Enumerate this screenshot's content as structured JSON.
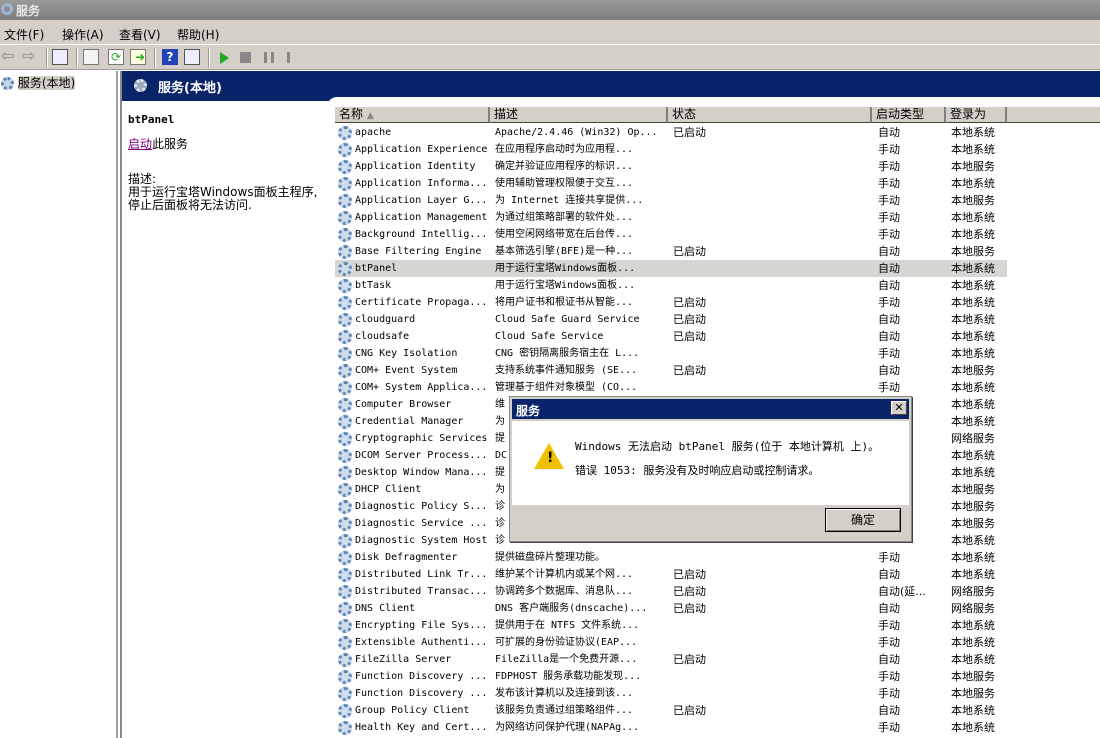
{
  "window": {
    "title": "服务"
  },
  "menu": [
    "文件(F)",
    "操作(A)",
    "查看(V)",
    "帮助(H)"
  ],
  "toolbar_icons": [
    "back-icon",
    "forward-icon",
    "show-hide-tree-icon",
    "properties-icon",
    "refresh-icon",
    "export-list-icon",
    "help-icon",
    "action-pane-icon",
    "start-icon",
    "stop-icon",
    "pause-icon",
    "resume-icon"
  ],
  "tree": {
    "item": "服务(本地)"
  },
  "panel": {
    "title": "服务(本地)",
    "service_name": "btPanel",
    "start_link": "启动",
    "start_suffix": "此服务",
    "desc_label": "描述:",
    "description": "用于运行宝塔Windows面板主程序,停止后面板将无法访问."
  },
  "columns": [
    "名称",
    "描述",
    "状态",
    "启动类型",
    "登录为"
  ],
  "services": [
    [
      "apache",
      "Apache/2.4.46 (Win32) Op...",
      "已启动",
      "自动",
      "本地系统"
    ],
    [
      "Application Experience",
      "在应用程序启动时为应用程...",
      "",
      "手动",
      "本地系统"
    ],
    [
      "Application Identity",
      "确定并验证应用程序的标识...",
      "",
      "手动",
      "本地服务"
    ],
    [
      "Application Informa...",
      "使用辅助管理权限便于交互...",
      "",
      "手动",
      "本地系统"
    ],
    [
      "Application Layer G...",
      "为 Internet 连接共享提供...",
      "",
      "手动",
      "本地服务"
    ],
    [
      "Application Management",
      "为通过组策略部署的软件处...",
      "",
      "手动",
      "本地系统"
    ],
    [
      "Background Intellig...",
      "使用空闲网络带宽在后台传...",
      "",
      "手动",
      "本地系统"
    ],
    [
      "Base Filtering Engine",
      "基本筛选引擎(BFE)是一种...",
      "已启动",
      "自动",
      "本地服务"
    ],
    [
      "btPanel",
      "用于运行宝塔Windows面板...",
      "",
      "自动",
      "本地系统"
    ],
    [
      "btTask",
      "用于运行宝塔Windows面板...",
      "",
      "自动",
      "本地系统"
    ],
    [
      "Certificate Propaga...",
      "将用户证书和根证书从智能...",
      "已启动",
      "手动",
      "本地系统"
    ],
    [
      "cloudguard",
      "Cloud Safe Guard Service",
      "已启动",
      "自动",
      "本地系统"
    ],
    [
      "cloudsafe",
      "Cloud Safe Service",
      "已启动",
      "自动",
      "本地系统"
    ],
    [
      "CNG Key Isolation",
      "CNG 密钥隔离服务宿主在 L...",
      "",
      "手动",
      "本地系统"
    ],
    [
      "COM+ Event System",
      "支持系统事件通知服务 (SE...",
      "已启动",
      "自动",
      "本地服务"
    ],
    [
      "COM+ System Applica...",
      "管理基于组件对象模型 (CO...",
      "",
      "手动",
      "本地系统"
    ],
    [
      "Computer Browser",
      "维",
      "",
      "",
      "本地系统"
    ],
    [
      "Credential Manager",
      "为",
      "",
      "",
      "本地系统"
    ],
    [
      "Cryptographic Services",
      "提",
      "",
      "",
      "网络服务"
    ],
    [
      "DCOM Server Process...",
      "DC",
      "",
      "",
      "本地系统"
    ],
    [
      "Desktop Window Mana...",
      "提",
      "",
      "",
      "本地系统"
    ],
    [
      "DHCP Client",
      "为",
      "",
      "",
      "本地服务"
    ],
    [
      "Diagnostic Policy S...",
      "诊",
      "",
      "证...",
      "本地服务"
    ],
    [
      "Diagnostic Service ...",
      "诊",
      "",
      "",
      "本地服务"
    ],
    [
      "Diagnostic System Host",
      "诊",
      "",
      "",
      "本地系统"
    ],
    [
      "Disk Defragmenter",
      "提供磁盘碎片整理功能。",
      "",
      "手动",
      "本地系统"
    ],
    [
      "Distributed Link Tr...",
      "维护某个计算机内或某个网...",
      "已启动",
      "自动",
      "本地系统"
    ],
    [
      "Distributed Transac...",
      "协调跨多个数据库、消息队...",
      "已启动",
      "自动(延...",
      "网络服务"
    ],
    [
      "DNS Client",
      "DNS 客户端服务(dnscache)...",
      "已启动",
      "自动",
      "网络服务"
    ],
    [
      "Encrypting File Sys...",
      "提供用于在 NTFS 文件系统...",
      "",
      "手动",
      "本地系统"
    ],
    [
      "Extensible Authenti...",
      "可扩展的身份验证协议(EAP...",
      "",
      "手动",
      "本地系统"
    ],
    [
      "FileZilla Server",
      "FileZilla是一个免费开源...",
      "已启动",
      "自动",
      "本地系统"
    ],
    [
      "Function Discovery ...",
      "FDPHOST 服务承载功能发现...",
      "",
      "手动",
      "本地服务"
    ],
    [
      "Function Discovery ...",
      "发布该计算机以及连接到该...",
      "",
      "手动",
      "本地服务"
    ],
    [
      "Group Policy Client",
      "该服务负责通过组策略组件...",
      "已启动",
      "自动",
      "本地系统"
    ],
    [
      "Health Key and Cert...",
      "为网络访问保护代理(NAPAg...",
      "",
      "手动",
      "本地系统"
    ]
  ],
  "selected_index": 8,
  "dialog": {
    "title": "服务",
    "line1": "Windows 无法启动 btPanel 服务(位于 本地计算机 上)。",
    "line2": "错误 1053: 服务没有及时响应启动或控制请求。",
    "ok": "确定",
    "close": "✕"
  }
}
